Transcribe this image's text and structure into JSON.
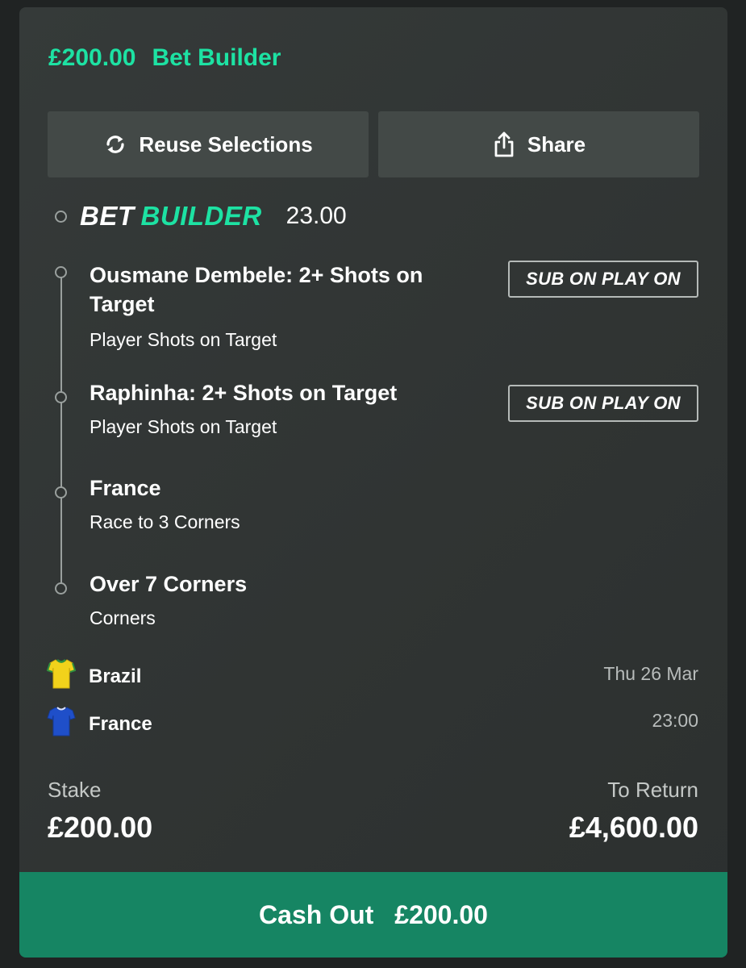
{
  "header": {
    "amount": "£200.00",
    "title": "Bet Builder"
  },
  "actions": {
    "reuse_label": "Reuse Selections",
    "share_label": "Share"
  },
  "bet_builder": {
    "logo_word1": "BET",
    "logo_word2": "BUILDER",
    "odds": "23.00"
  },
  "legs": [
    {
      "title": "Ousmane Dembele: 2+ Shots on Target",
      "market": "Player Shots on Target",
      "badge": "SUB ON PLAY ON"
    },
    {
      "title": "Raphinha: 2+ Shots on Target",
      "market": "Player Shots on Target",
      "badge": "SUB ON PLAY ON"
    },
    {
      "title": "France",
      "market": "Race to 3 Corners"
    },
    {
      "title": "Over 7 Corners",
      "market": "Corners"
    }
  ],
  "event": {
    "home_team": "Brazil",
    "away_team": "France",
    "date": "Thu 26 Mar",
    "time": "23:00",
    "home_kit_color": "#f2d21b",
    "away_kit_color": "#1f4fc9"
  },
  "totals": {
    "stake_label": "Stake",
    "stake_value": "£200.00",
    "return_label": "To Return",
    "return_value": "£4,600.00"
  },
  "cashout": {
    "label": "Cash Out",
    "amount": "£200.00"
  },
  "colors": {
    "accent": "#1de2a3",
    "cashout_bg": "#168563",
    "card_bg": "#323736"
  }
}
